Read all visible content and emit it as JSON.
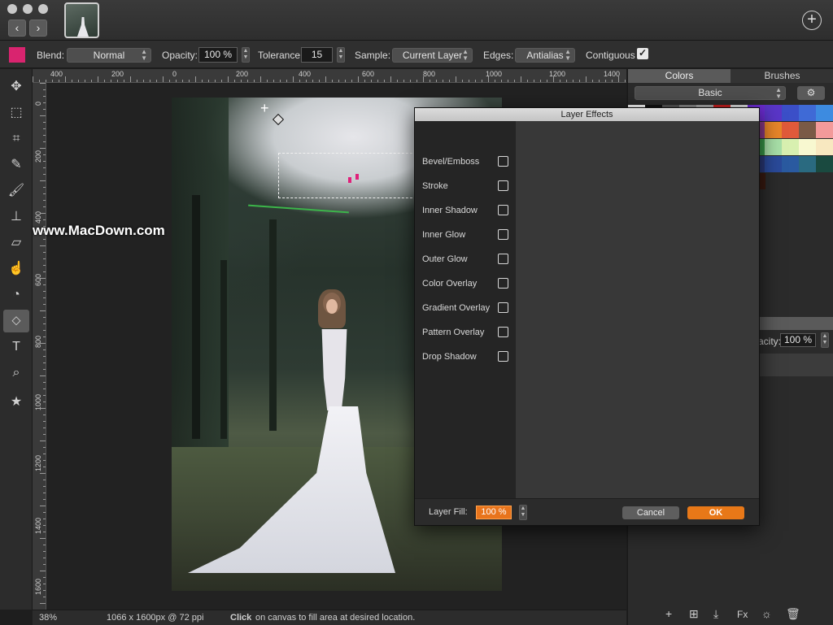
{
  "toolbar": {
    "back_icon": "chevron-left-icon",
    "forward_icon": "chevron-right-icon",
    "add_icon": "plus-circle-icon"
  },
  "options": {
    "color_swatch": "#d9246f",
    "blend_label": "Blend:",
    "blend_value": "Normal",
    "opacity_label": "Opacity:",
    "opacity_value": "100 %",
    "tolerance_label": "Tolerance:",
    "tolerance_value": "15",
    "sample_label": "Sample:",
    "sample_value": "Current Layer",
    "edges_label": "Edges:",
    "edges_value": "Antialias",
    "contiguous_label": "Contiguous",
    "contiguous_checked": true
  },
  "tools": [
    {
      "name": "move-tool",
      "icon": "move-icon"
    },
    {
      "name": "marquee-tool",
      "icon": "marquee-icon"
    },
    {
      "name": "crop-tool",
      "icon": "crop-icon"
    },
    {
      "name": "eyedropper-tool",
      "icon": "eyedropper-icon"
    },
    {
      "name": "brush-tool",
      "icon": "brush-icon"
    },
    {
      "name": "stamp-tool",
      "icon": "stamp-icon"
    },
    {
      "name": "eraser-tool",
      "icon": "eraser-icon"
    },
    {
      "name": "smudge-tool",
      "icon": "smudge-icon"
    },
    {
      "name": "dodge-tool",
      "icon": "dodge-icon"
    },
    {
      "name": "fill-tool",
      "icon": "paint-bucket-icon",
      "active": true
    },
    {
      "name": "text-tool",
      "icon": "text-icon"
    },
    {
      "name": "zoom-tool",
      "icon": "zoom-icon"
    },
    {
      "name": "favorites-tool",
      "icon": "star-icon"
    }
  ],
  "hruler_labels": [
    "400",
    "200",
    "0",
    "200",
    "400",
    "600",
    "800",
    "1000",
    "1200",
    "1400"
  ],
  "vruler_labels": [
    "0",
    "200",
    "400",
    "600",
    "800",
    "1000",
    "1200",
    "1400",
    "1600"
  ],
  "watermark": "www.MacDown.com",
  "status": {
    "zoom": "38%",
    "dimensions": "1066 x 1600px @ 72 ppi",
    "hint_bold": "Click",
    "hint_rest": "on canvas to fill area at desired location."
  },
  "right_panel": {
    "tab_colors": "Colors",
    "tab_brushes": "Brushes",
    "palette_value": "Basic",
    "opacity_label": "acity:",
    "opacity_value": "100 %"
  },
  "dialog": {
    "title": "Layer Effects",
    "effects": [
      {
        "label": "Bevel/Emboss",
        "checked": false
      },
      {
        "label": "Stroke",
        "checked": false
      },
      {
        "label": "Inner Shadow",
        "checked": false
      },
      {
        "label": "Inner Glow",
        "checked": false
      },
      {
        "label": "Outer Glow",
        "checked": false
      },
      {
        "label": "Color Overlay",
        "checked": false
      },
      {
        "label": "Gradient Overlay",
        "checked": false
      },
      {
        "label": "Pattern Overlay",
        "checked": false
      },
      {
        "label": "Drop Shadow",
        "checked": false
      }
    ],
    "layer_fill_label": "Layer Fill:",
    "layer_fill_value": "100 %",
    "cancel_label": "Cancel",
    "ok_label": "OK"
  },
  "colors": {
    "accent": "#e87818",
    "background": "#1e1e1e"
  }
}
